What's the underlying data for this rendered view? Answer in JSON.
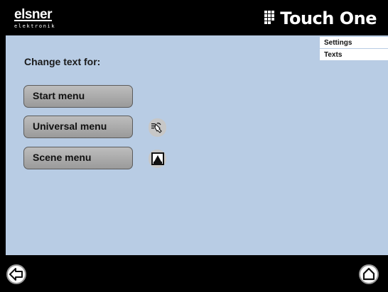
{
  "header": {
    "brand_name": "elsner",
    "brand_subline": "elektronik",
    "product_title": "Touch One"
  },
  "breadcrumbs": [
    "Settings",
    "Texts"
  ],
  "content": {
    "heading": "Change text for:",
    "buttons": [
      {
        "label": "Start menu",
        "icon": null
      },
      {
        "label": "Universal menu",
        "icon": "hand-pointer-icon"
      },
      {
        "label": "Scene menu",
        "icon": "scene-icon"
      }
    ]
  },
  "footer": {
    "back_icon": "back-arrow-icon",
    "home_icon": "home-icon"
  },
  "colors": {
    "content_background": "#b8cce4",
    "bars": "#000000",
    "button_fill": "#a9a9a9"
  }
}
